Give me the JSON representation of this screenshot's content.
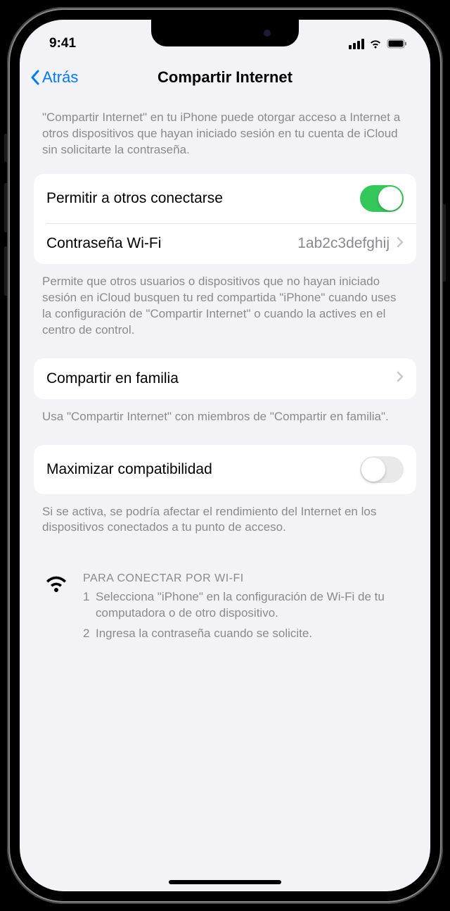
{
  "status": {
    "time": "9:41"
  },
  "nav": {
    "back_label": "Atrás",
    "title": "Compartir Internet"
  },
  "intro": "\"Compartir Internet\" en tu iPhone puede otorgar acceso a Internet a otros dispositivos que hayan iniciado sesión en tu cuenta de iCloud sin solicitarte la contraseña.",
  "settings": {
    "allow_others": {
      "label": "Permitir a otros conectarse",
      "enabled": true
    },
    "wifi_password": {
      "label": "Contraseña Wi-Fi",
      "value": "1ab2c3defghij"
    }
  },
  "allow_footer": "Permite que otros usuarios o dispositivos que no hayan iniciado sesión en iCloud busquen tu red compartida \"iPhone\" cuando uses la configuración de \"Compartir Internet\" o cuando la actives en el centro de control.",
  "family": {
    "label": "Compartir en familia",
    "footer": "Usa \"Compartir Internet\" con miembros de \"Compartir en familia\"."
  },
  "compat": {
    "label": "Maximizar compatibilidad",
    "enabled": false,
    "footer": "Si se activa, se podría afectar el rendimiento del Internet en los dispositivos conectados a tu punto de acceso."
  },
  "instructions": {
    "heading": "PARA CONECTAR POR WI-FI",
    "steps": [
      "Selecciona \"iPhone\" en la configuración de Wi-Fi de tu computadora o de otro dispositivo.",
      "Ingresa la contraseña cuando se solicite."
    ]
  }
}
